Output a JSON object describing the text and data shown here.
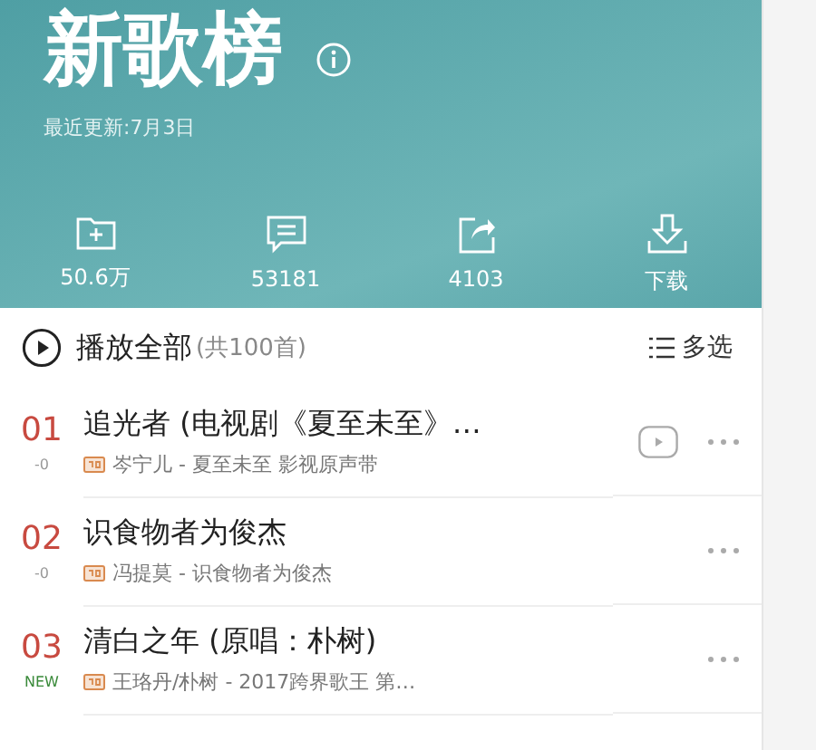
{
  "header": {
    "title": "新歌榜",
    "updated": "最近更新:7月3日"
  },
  "stats": [
    {
      "kind": "collect",
      "label": "50.6万"
    },
    {
      "kind": "comment",
      "label": "53181"
    },
    {
      "kind": "share",
      "label": "4103"
    },
    {
      "kind": "download",
      "label": "下载"
    }
  ],
  "play_all": {
    "label": "播放全部",
    "count": "(共100首)",
    "multi_select": "多选"
  },
  "songs": [
    {
      "rank": "01",
      "change": "-0",
      "color": "#999999",
      "title": "追光者 (电视剧《夏至未至》…",
      "subtitle": "岑宁儿 - 夏至未至 影视原声带",
      "mv": true
    },
    {
      "rank": "02",
      "change": "-0",
      "color": "#999999",
      "title": "识食物者为俊杰",
      "subtitle": "冯提莫 - 识食物者为俊杰",
      "mv": false
    },
    {
      "rank": "03",
      "change": "NEW",
      "color": "#3a8a3a",
      "title": "清白之年 (原唱：朴树)",
      "subtitle": "王珞丹/朴树 - 2017跨界歌王 第…",
      "mv": false
    }
  ]
}
